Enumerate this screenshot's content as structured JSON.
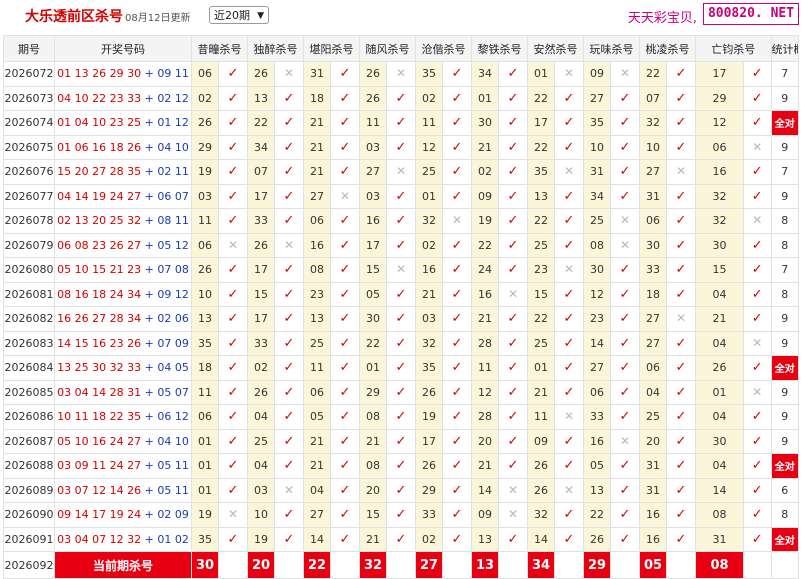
{
  "header": {
    "title": "大乐透前区杀号",
    "date": "08月12日更新",
    "select_value": "近20期",
    "site_name": "天天彩宝贝,",
    "logo": "800820. NET"
  },
  "columns": [
    "期号",
    "开奖号码",
    "昔疃杀号",
    "独醉杀号",
    "堪阳杀号",
    "随风杀号",
    "沧偕杀号",
    "黎铁杀号",
    "安然杀号",
    "玩味杀号",
    "桃凌杀号",
    "亡钧杀号",
    "统计概况"
  ],
  "rows": [
    {
      "period": "2026072",
      "front": "01 13 26 29 30",
      "back": "09 11",
      "kills": [
        [
          "06",
          1
        ],
        [
          "26",
          0
        ],
        [
          "31",
          1
        ],
        [
          "26",
          0
        ],
        [
          "35",
          1
        ],
        [
          "34",
          1
        ],
        [
          "01",
          0
        ],
        [
          "09",
          0
        ],
        [
          "22",
          1
        ],
        [
          "17",
          1
        ]
      ],
      "stat": "7"
    },
    {
      "period": "2026073",
      "front": "04 10 22 23 33",
      "back": "02 12",
      "kills": [
        [
          "02",
          1
        ],
        [
          "13",
          1
        ],
        [
          "18",
          1
        ],
        [
          "26",
          1
        ],
        [
          "02",
          1
        ],
        [
          "01",
          1
        ],
        [
          "22",
          1
        ],
        [
          "27",
          1
        ],
        [
          "07",
          1
        ],
        [
          "29",
          1
        ]
      ],
      "stat": "9"
    },
    {
      "period": "2026074",
      "front": "01 04 10 23 25",
      "back": "01 12",
      "kills": [
        [
          "26",
          1
        ],
        [
          "22",
          1
        ],
        [
          "21",
          1
        ],
        [
          "11",
          1
        ],
        [
          "11",
          1
        ],
        [
          "30",
          1
        ],
        [
          "17",
          1
        ],
        [
          "35",
          1
        ],
        [
          "32",
          1
        ],
        [
          "12",
          1
        ]
      ],
      "stat": "全对"
    },
    {
      "period": "2026075",
      "front": "01 06 16 18 26",
      "back": "04 10",
      "kills": [
        [
          "29",
          1
        ],
        [
          "34",
          1
        ],
        [
          "21",
          1
        ],
        [
          "03",
          1
        ],
        [
          "12",
          1
        ],
        [
          "21",
          1
        ],
        [
          "22",
          1
        ],
        [
          "10",
          1
        ],
        [
          "10",
          1
        ],
        [
          "06",
          0
        ]
      ],
      "stat": "9"
    },
    {
      "period": "2026076",
      "front": "15 20 27 28 35",
      "back": "02 11",
      "kills": [
        [
          "19",
          1
        ],
        [
          "07",
          1
        ],
        [
          "21",
          1
        ],
        [
          "27",
          0
        ],
        [
          "25",
          1
        ],
        [
          "02",
          1
        ],
        [
          "35",
          0
        ],
        [
          "31",
          1
        ],
        [
          "27",
          0
        ],
        [
          "16",
          1
        ]
      ],
      "stat": "7"
    },
    {
      "period": "2026077",
      "front": "04 14 19 24 27",
      "back": "06 07",
      "kills": [
        [
          "03",
          1
        ],
        [
          "17",
          1
        ],
        [
          "27",
          0
        ],
        [
          "03",
          1
        ],
        [
          "01",
          1
        ],
        [
          "09",
          1
        ],
        [
          "13",
          1
        ],
        [
          "34",
          1
        ],
        [
          "31",
          1
        ],
        [
          "32",
          1
        ]
      ],
      "stat": "9"
    },
    {
      "period": "2026078",
      "front": "02 13 20 25 32",
      "back": "08 11",
      "kills": [
        [
          "11",
          1
        ],
        [
          "33",
          1
        ],
        [
          "06",
          1
        ],
        [
          "16",
          1
        ],
        [
          "32",
          0
        ],
        [
          "19",
          1
        ],
        [
          "22",
          1
        ],
        [
          "25",
          0
        ],
        [
          "06",
          1
        ],
        [
          "32",
          0
        ]
      ],
      "stat": "8"
    },
    {
      "period": "2026079",
      "front": "06 08 23 26 27",
      "back": "05 12",
      "kills": [
        [
          "06",
          0
        ],
        [
          "26",
          0
        ],
        [
          "16",
          1
        ],
        [
          "17",
          1
        ],
        [
          "02",
          1
        ],
        [
          "22",
          1
        ],
        [
          "25",
          1
        ],
        [
          "08",
          0
        ],
        [
          "30",
          1
        ],
        [
          "30",
          1
        ]
      ],
      "stat": "8"
    },
    {
      "period": "2026080",
      "front": "05 10 15 21 23",
      "back": "07 08",
      "kills": [
        [
          "26",
          1
        ],
        [
          "17",
          1
        ],
        [
          "08",
          1
        ],
        [
          "15",
          0
        ],
        [
          "16",
          1
        ],
        [
          "24",
          1
        ],
        [
          "23",
          0
        ],
        [
          "30",
          1
        ],
        [
          "33",
          1
        ],
        [
          "15",
          1
        ]
      ],
      "stat": "7"
    },
    {
      "period": "2026081",
      "front": "08 16 18 24 34",
      "back": "09 12",
      "kills": [
        [
          "10",
          1
        ],
        [
          "15",
          1
        ],
        [
          "23",
          1
        ],
        [
          "05",
          1
        ],
        [
          "21",
          1
        ],
        [
          "16",
          0
        ],
        [
          "15",
          1
        ],
        [
          "12",
          1
        ],
        [
          "18",
          1
        ],
        [
          "04",
          1
        ]
      ],
      "stat": "8"
    },
    {
      "period": "2026082",
      "front": "16 26 27 28 34",
      "back": "02 06",
      "kills": [
        [
          "13",
          1
        ],
        [
          "17",
          1
        ],
        [
          "13",
          1
        ],
        [
          "30",
          1
        ],
        [
          "03",
          1
        ],
        [
          "21",
          1
        ],
        [
          "22",
          1
        ],
        [
          "23",
          1
        ],
        [
          "27",
          0
        ],
        [
          "21",
          1
        ]
      ],
      "stat": "9"
    },
    {
      "period": "2026083",
      "front": "14 15 16 23 26",
      "back": "07 09",
      "kills": [
        [
          "35",
          1
        ],
        [
          "33",
          1
        ],
        [
          "25",
          1
        ],
        [
          "22",
          1
        ],
        [
          "32",
          1
        ],
        [
          "28",
          1
        ],
        [
          "25",
          1
        ],
        [
          "14",
          1
        ],
        [
          "27",
          1
        ],
        [
          "04",
          0
        ]
      ],
      "stat": "9"
    },
    {
      "period": "2026084",
      "front": "13 25 30 32 33",
      "back": "04 05",
      "kills": [
        [
          "18",
          1
        ],
        [
          "02",
          1
        ],
        [
          "11",
          1
        ],
        [
          "01",
          1
        ],
        [
          "35",
          1
        ],
        [
          "11",
          1
        ],
        [
          "01",
          1
        ],
        [
          "27",
          1
        ],
        [
          "06",
          1
        ],
        [
          "26",
          1
        ]
      ],
      "stat": "全对"
    },
    {
      "period": "2026085",
      "front": "03 04 14 28 31",
      "back": "05 07",
      "kills": [
        [
          "11",
          1
        ],
        [
          "26",
          1
        ],
        [
          "06",
          1
        ],
        [
          "29",
          1
        ],
        [
          "26",
          1
        ],
        [
          "12",
          1
        ],
        [
          "21",
          1
        ],
        [
          "06",
          1
        ],
        [
          "04",
          1
        ],
        [
          "01",
          0
        ]
      ],
      "stat": "9"
    },
    {
      "period": "2026086",
      "front": "10 11 18 22 35",
      "back": "06 12",
      "kills": [
        [
          "06",
          1
        ],
        [
          "04",
          1
        ],
        [
          "05",
          1
        ],
        [
          "08",
          1
        ],
        [
          "19",
          1
        ],
        [
          "28",
          1
        ],
        [
          "11",
          0
        ],
        [
          "33",
          1
        ],
        [
          "25",
          1
        ],
        [
          "04",
          1
        ]
      ],
      "stat": "9"
    },
    {
      "period": "2026087",
      "front": "05 10 16 24 27",
      "back": "04 10",
      "kills": [
        [
          "01",
          1
        ],
        [
          "25",
          1
        ],
        [
          "21",
          1
        ],
        [
          "21",
          1
        ],
        [
          "17",
          1
        ],
        [
          "20",
          1
        ],
        [
          "09",
          1
        ],
        [
          "16",
          0
        ],
        [
          "20",
          1
        ],
        [
          "30",
          1
        ]
      ],
      "stat": "9"
    },
    {
      "period": "2026088",
      "front": "03 09 11 24 27",
      "back": "05 11",
      "kills": [
        [
          "01",
          1
        ],
        [
          "04",
          1
        ],
        [
          "21",
          1
        ],
        [
          "08",
          1
        ],
        [
          "26",
          1
        ],
        [
          "21",
          1
        ],
        [
          "26",
          1
        ],
        [
          "05",
          1
        ],
        [
          "31",
          1
        ],
        [
          "04",
          1
        ]
      ],
      "stat": "全对"
    },
    {
      "period": "2026089",
      "front": "03 07 12 14 26",
      "back": "05 11",
      "kills": [
        [
          "01",
          1
        ],
        [
          "03",
          0
        ],
        [
          "04",
          1
        ],
        [
          "20",
          1
        ],
        [
          "29",
          1
        ],
        [
          "14",
          0
        ],
        [
          "26",
          0
        ],
        [
          "13",
          1
        ],
        [
          "31",
          1
        ],
        [
          "14",
          1
        ]
      ],
      "stat": "6"
    },
    {
      "period": "2026090",
      "front": "09 14 17 19 24",
      "back": "02 09",
      "kills": [
        [
          "19",
          0
        ],
        [
          "10",
          1
        ],
        [
          "27",
          1
        ],
        [
          "15",
          1
        ],
        [
          "33",
          1
        ],
        [
          "09",
          0
        ],
        [
          "32",
          1
        ],
        [
          "22",
          1
        ],
        [
          "16",
          1
        ],
        [
          "08",
          1
        ]
      ],
      "stat": "8"
    },
    {
      "period": "2026091",
      "front": "03 04 07 12 32",
      "back": "01 02",
      "kills": [
        [
          "35",
          1
        ],
        [
          "19",
          1
        ],
        [
          "14",
          1
        ],
        [
          "21",
          1
        ],
        [
          "02",
          1
        ],
        [
          "13",
          1
        ],
        [
          "14",
          1
        ],
        [
          "26",
          1
        ],
        [
          "16",
          1
        ],
        [
          "31",
          1
        ]
      ],
      "stat": "全对"
    }
  ],
  "current": {
    "period": "2026092",
    "label": "当前期杀号",
    "kills": [
      "30",
      "20",
      "22",
      "32",
      "27",
      "13",
      "34",
      "29",
      "05",
      "08"
    ]
  },
  "marks": {
    "ok": "✓",
    "ng": "✕"
  }
}
